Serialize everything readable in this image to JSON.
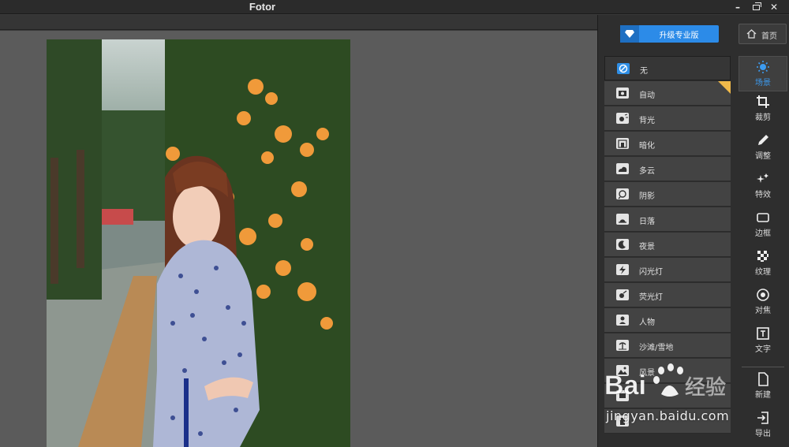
{
  "window": {
    "title": "Fotor",
    "minimize": "–",
    "close": "✕"
  },
  "header": {
    "pro_button": "升级专业版",
    "home_button": "首页"
  },
  "scenes": [
    {
      "label": "无",
      "icon": "none-icon",
      "active": true
    },
    {
      "label": "自动",
      "icon": "camera-icon"
    },
    {
      "label": "背光",
      "icon": "backlight-icon"
    },
    {
      "label": "暗化",
      "icon": "darken-icon"
    },
    {
      "label": "多云",
      "icon": "cloud-icon"
    },
    {
      "label": "阴影",
      "icon": "shadow-icon"
    },
    {
      "label": "日落",
      "icon": "sunset-icon"
    },
    {
      "label": "夜景",
      "icon": "night-icon"
    },
    {
      "label": "闪光灯",
      "icon": "flash-icon"
    },
    {
      "label": "荧光灯",
      "icon": "fluorescent-icon"
    },
    {
      "label": "人物",
      "icon": "portrait-icon"
    },
    {
      "label": "沙滩/雪地",
      "icon": "beach-icon"
    },
    {
      "label": "风景",
      "icon": "landscape-icon"
    },
    {
      "label": "",
      "icon": "food-icon"
    },
    {
      "label": "",
      "icon": "building-icon"
    }
  ],
  "tools": [
    {
      "label": "场景",
      "icon": "scene-icon",
      "active": true
    },
    {
      "label": "裁剪",
      "icon": "crop-icon"
    },
    {
      "label": "调整",
      "icon": "adjust-icon"
    },
    {
      "label": "特效",
      "icon": "effects-icon"
    },
    {
      "label": "边框",
      "icon": "border-icon"
    },
    {
      "label": "纹理",
      "icon": "texture-icon"
    },
    {
      "label": "对焦",
      "icon": "focus-icon"
    },
    {
      "label": "文字",
      "icon": "text-icon"
    }
  ],
  "file_tools": [
    {
      "label": "新建",
      "icon": "new-file-icon"
    },
    {
      "label": "导出",
      "icon": "export-icon"
    }
  ],
  "watermark": {
    "text": "jingyan.baidu.com",
    "logo": "Baidu经验"
  },
  "colors": {
    "accent": "#2c8be8",
    "badge": "#f0b94a",
    "panel": "#2e2e2e",
    "canvas": "#5b5b5b"
  }
}
